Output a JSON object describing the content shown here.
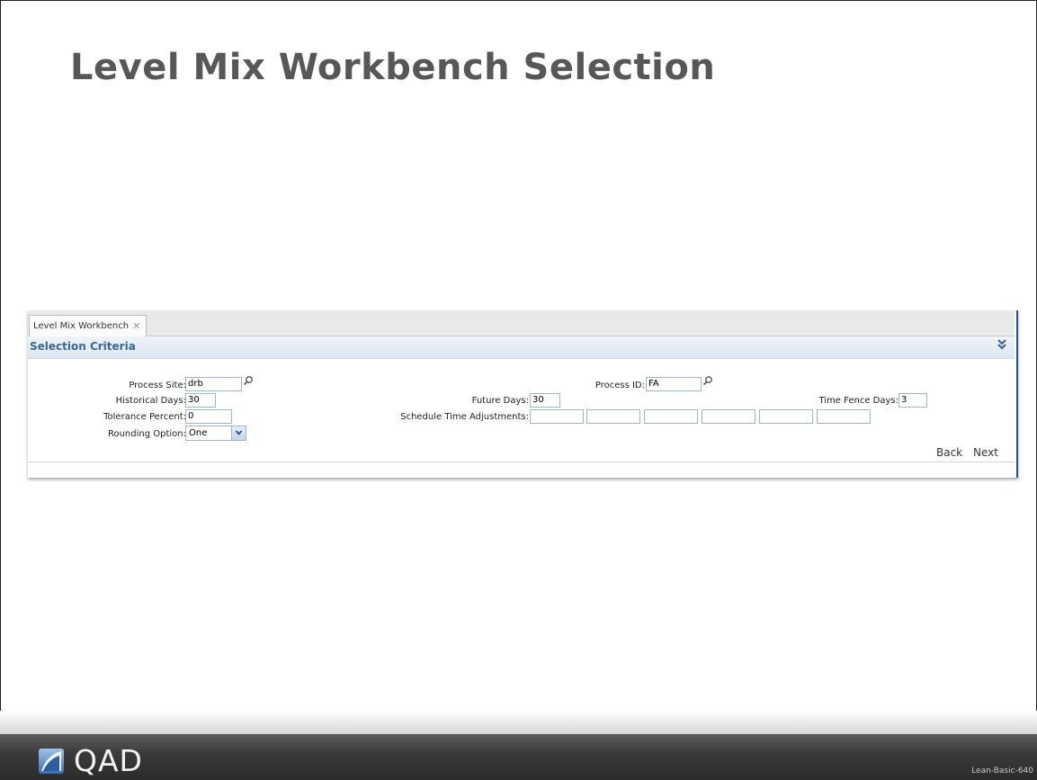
{
  "slide": {
    "title": "Level Mix Workbench Selection",
    "footer_id": "Lean-Basic-640",
    "logo_text": "QAD"
  },
  "window": {
    "tab_label": "Level Mix Workbench",
    "tab_close_glyph": "✕",
    "section_title": "Selection Criteria",
    "collapse_glyph": "»"
  },
  "form": {
    "process_site": {
      "label": "Process Site:",
      "value": "drb"
    },
    "process_id": {
      "label": "Process ID:",
      "value": "FA"
    },
    "historical_days": {
      "label": "Historical Days:",
      "value": "30"
    },
    "future_days": {
      "label": "Future Days:",
      "value": "30"
    },
    "time_fence_days": {
      "label": "Time Fence Days:",
      "value": "3"
    },
    "tolerance_percent": {
      "label": "Tolerance Percent:",
      "value": "0"
    },
    "schedule_time_adjustments": {
      "label": "Schedule Time Adjustments:",
      "values": [
        "",
        "",
        "",
        "",
        "",
        ""
      ]
    },
    "rounding_option": {
      "label": "Rounding Option:",
      "value": "One"
    }
  },
  "actions": {
    "back": "Back",
    "next": "Next"
  },
  "colors": {
    "title": "#575757",
    "section_title": "#3a6797",
    "panel_accent": "#2a4fa0",
    "footer_bar": "#3b3b3b"
  },
  "icons": {
    "lookup": "search-icon",
    "collapse": "double-chevron-icon",
    "close": "close-icon",
    "dropdown": "chevron-down-icon"
  }
}
